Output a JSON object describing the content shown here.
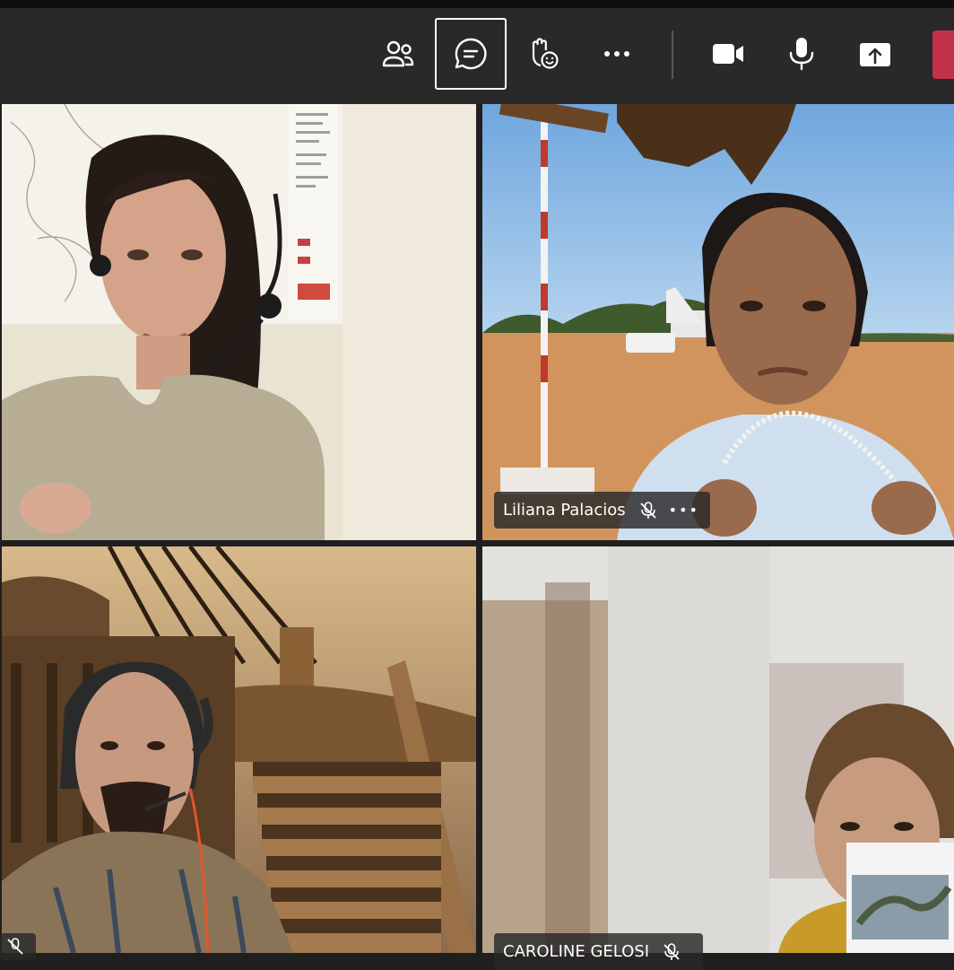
{
  "toolbar": {
    "buttons": [
      {
        "icon": "people-icon",
        "label": "Participants"
      },
      {
        "icon": "chat-icon",
        "label": "Chat",
        "active": true
      },
      {
        "icon": "raise-hand-icon",
        "label": "Reactions"
      },
      {
        "icon": "more-icon",
        "label": "More actions"
      },
      {
        "icon": "camera-icon",
        "label": "Camera"
      },
      {
        "icon": "mic-icon",
        "label": "Mic"
      },
      {
        "icon": "share-icon",
        "label": "Share"
      }
    ],
    "leave_color": "#c4314b"
  },
  "participants": [
    {
      "name": "",
      "position": "top-left"
    },
    {
      "name": "Liliana Palacios",
      "muted": true,
      "position": "top-right"
    },
    {
      "name": "",
      "muted": true,
      "position": "bottom-left"
    },
    {
      "name": "CAROLINE GELOSI",
      "muted": true,
      "position": "bottom-right"
    }
  ],
  "colors": {
    "toolbar_bg": "#292929",
    "grid_bg": "#1f1f1f",
    "accent": "#c4314b"
  }
}
